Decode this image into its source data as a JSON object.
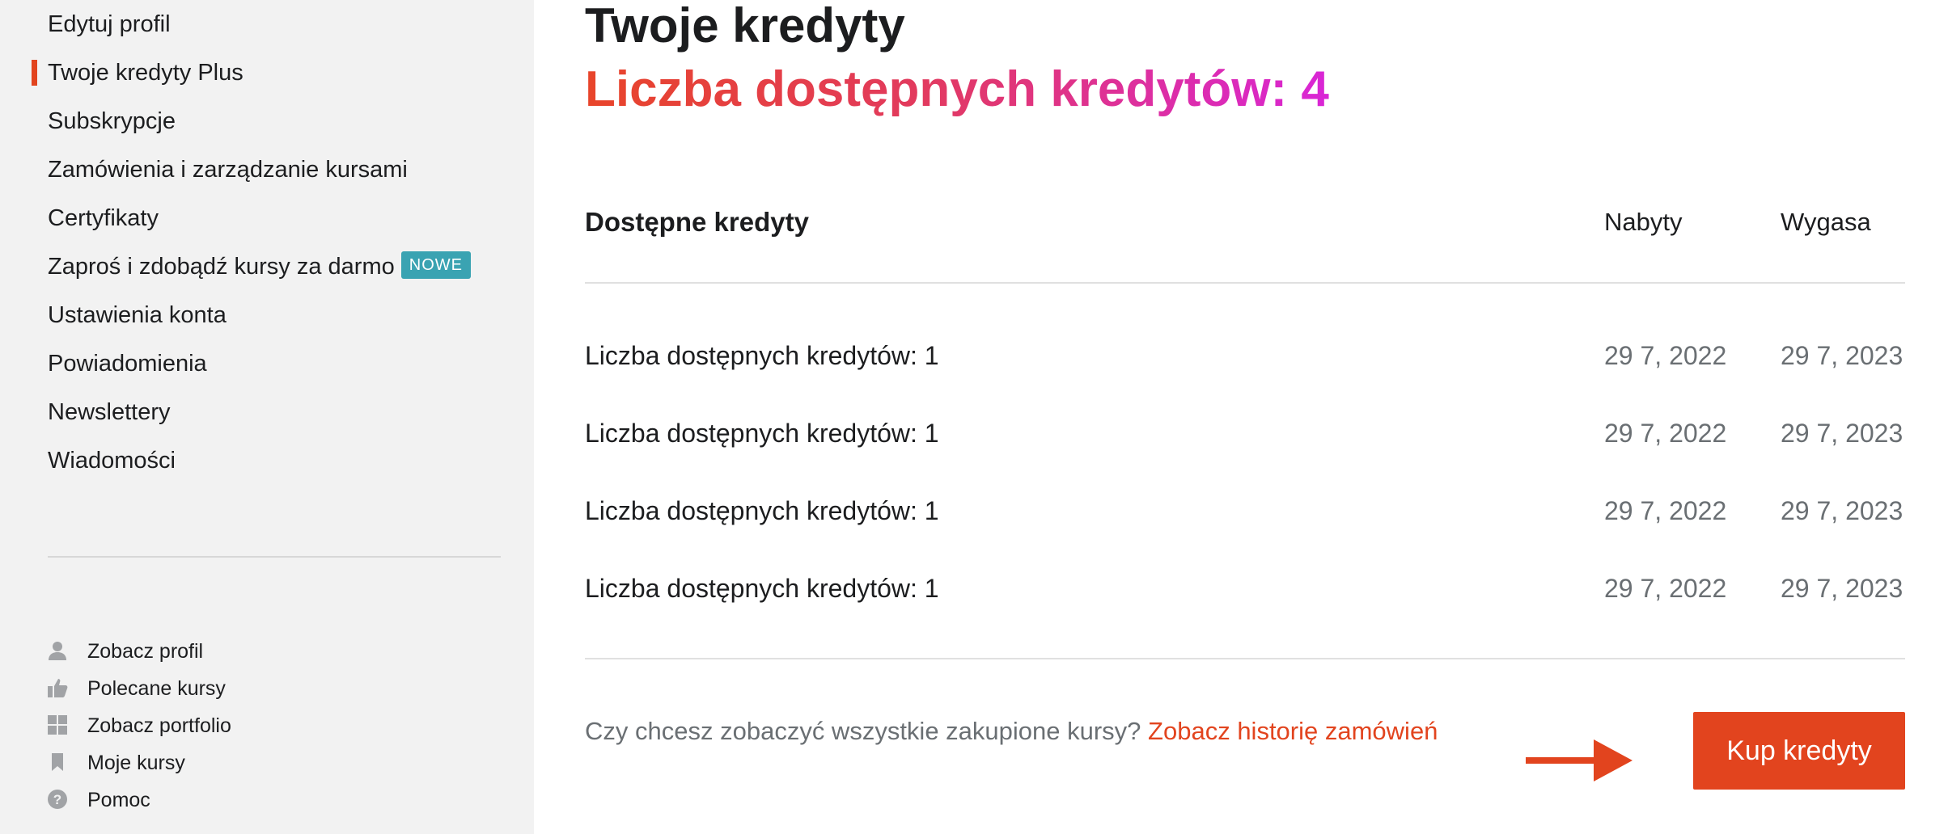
{
  "sidebar": {
    "items": [
      {
        "label": "Edytuj profil"
      },
      {
        "label": "Twoje kredyty Plus",
        "active": true
      },
      {
        "label": "Subskrypcje"
      },
      {
        "label": "Zamówienia i zarządzanie kursami"
      },
      {
        "label": "Certyfikaty"
      },
      {
        "label": "Zaproś i zdobądź kursy za darmo",
        "badge": "NOWE"
      },
      {
        "label": "Ustawienia konta"
      },
      {
        "label": "Powiadomienia"
      },
      {
        "label": "Newslettery"
      },
      {
        "label": "Wiadomości"
      }
    ],
    "secondary": [
      {
        "label": "Zobacz profil",
        "icon": "person-icon"
      },
      {
        "label": "Polecane kursy",
        "icon": "thumbs-up-icon"
      },
      {
        "label": "Zobacz portfolio",
        "icon": "grid-icon"
      },
      {
        "label": "Moje kursy",
        "icon": "bookmark-icon"
      },
      {
        "label": "Pomoc",
        "icon": "help-icon"
      }
    ]
  },
  "main": {
    "title": "Twoje kredyty",
    "credit_count_label": "Liczba dostępnych kredytów: 4",
    "table": {
      "headers": [
        "Dostępne kredyty",
        "Nabyty",
        "Wygasa"
      ],
      "rows": [
        [
          "Liczba dostępnych kredytów: 1",
          "29 7, 2022",
          "29 7, 2023"
        ],
        [
          "Liczba dostępnych kredytów: 1",
          "29 7, 2022",
          "29 7, 2023"
        ],
        [
          "Liczba dostępnych kredytów: 1",
          "29 7, 2022",
          "29 7, 2023"
        ],
        [
          "Liczba dostępnych kredytów: 1",
          "29 7, 2022",
          "29 7, 2023"
        ]
      ]
    },
    "footer": {
      "question": "Czy chcesz zobaczyć wszystkie zakupione kursy?",
      "link": "Zobacz historię zamówień"
    },
    "buy_button": "Kup kredyty"
  },
  "colors": {
    "accent": "#e2441e",
    "badge": "#3aa3b2",
    "gradient_start": "#e8452a",
    "gradient_end": "#d926d6"
  }
}
